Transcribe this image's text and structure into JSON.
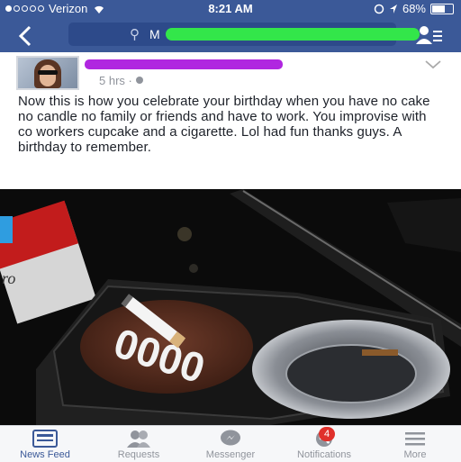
{
  "status_bar": {
    "carrier": "Verizon",
    "time": "8:21 AM",
    "battery": "68%"
  },
  "nav": {
    "back_label": "<",
    "search_value": "M"
  },
  "post": {
    "timestamp": "5 hrs · ",
    "body": "Now this is how you celebrate your birthday when you have no cake no candle no family or friends and have to work. You improvise with co workers cupcake and a cigarette.  Lol had fun thanks guys.  A birthday to remember."
  },
  "photo": {
    "cupcake_text": "0000"
  },
  "tabbar": {
    "items": [
      {
        "label": "News Feed",
        "icon": "news-feed-icon",
        "active": true
      },
      {
        "label": "Requests",
        "icon": "requests-icon",
        "active": false
      },
      {
        "label": "Messenger",
        "icon": "messenger-icon",
        "active": false
      },
      {
        "label": "Notifications",
        "icon": "globe-icon",
        "active": false,
        "badge": "4"
      },
      {
        "label": "More",
        "icon": "menu-icon",
        "active": false
      }
    ]
  },
  "colors": {
    "facebook_blue": "#3b5998",
    "badge_red": "#e0302b"
  }
}
